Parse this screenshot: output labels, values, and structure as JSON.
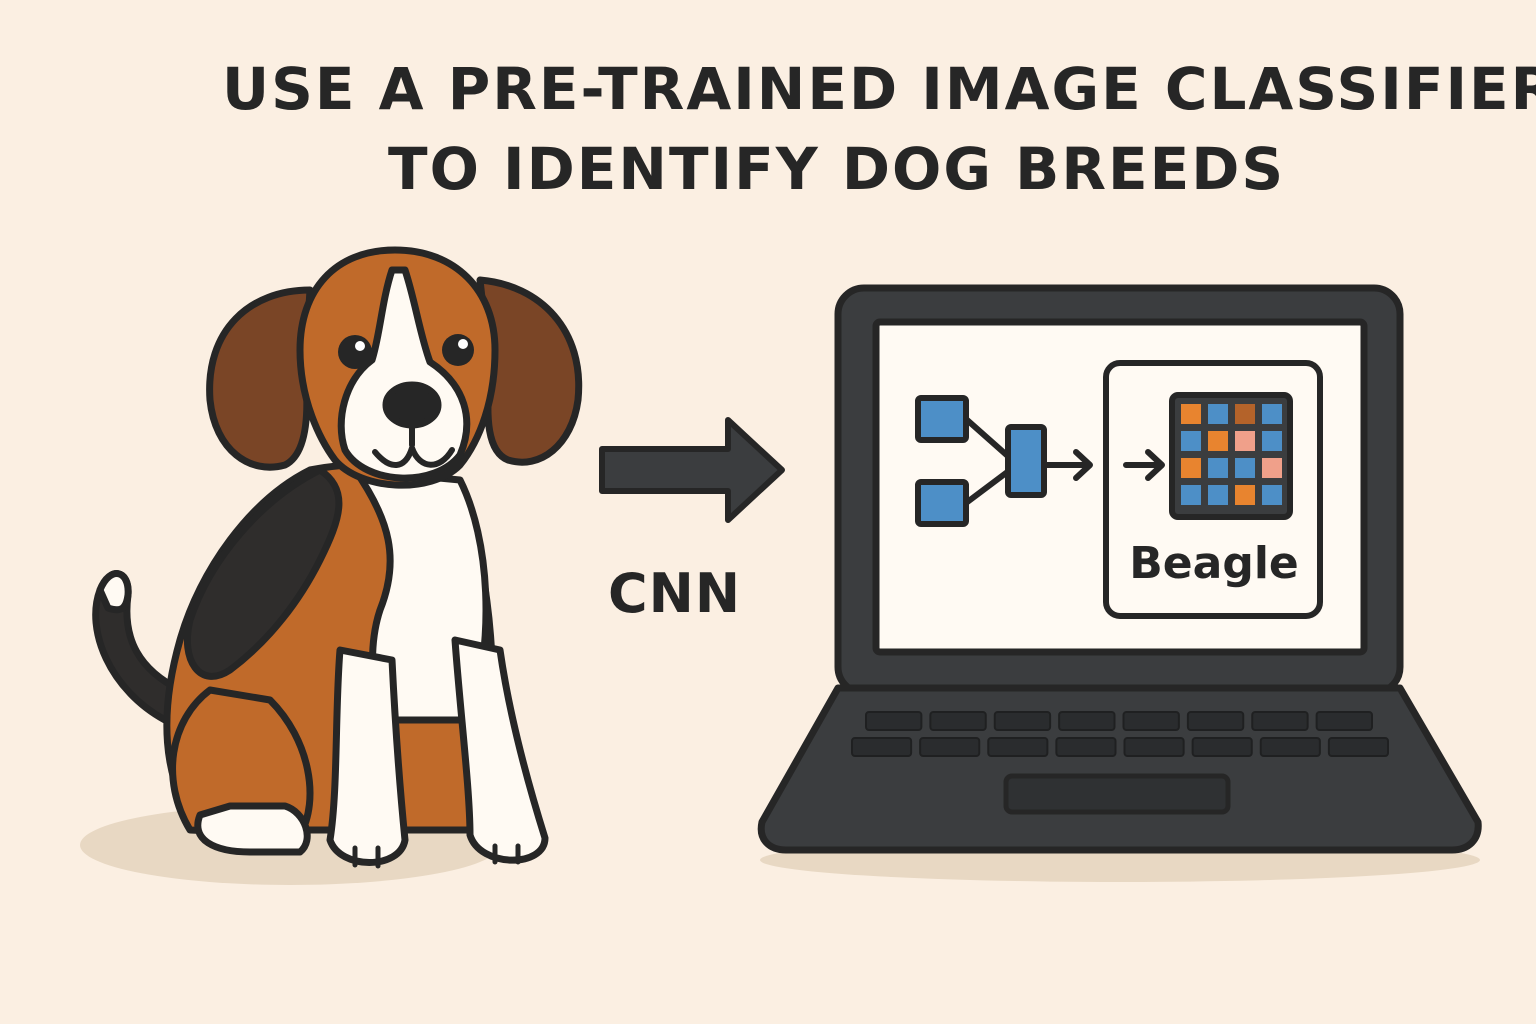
{
  "title": {
    "line1": "Use a pre-trained image classifier",
    "line2": "to identify dog breeds"
  },
  "arrow_label": "CNN",
  "result_label": "Beagle",
  "colors": {
    "background": "#fbefe2",
    "outline": "#262626",
    "fur_brown": "#c06a2a",
    "ear_brown": "#7a4526",
    "fur_black": "#2f2d2c",
    "fur_white": "#fffaf3",
    "laptop_body": "#3b3d3f",
    "node_blue": "#4d8fc7"
  },
  "grid_colors": [
    [
      "#e8842f",
      "#4d8fc7",
      "#b4632a",
      "#4d8fc7"
    ],
    [
      "#4d8fc7",
      "#e8842f",
      "#f0a08a",
      "#4d8fc7"
    ],
    [
      "#e8842f",
      "#4d8fc7",
      "#4d8fc7",
      "#f0a08a"
    ],
    [
      "#4d8fc7",
      "#4d8fc7",
      "#e8842f",
      "#4d8fc7"
    ]
  ]
}
